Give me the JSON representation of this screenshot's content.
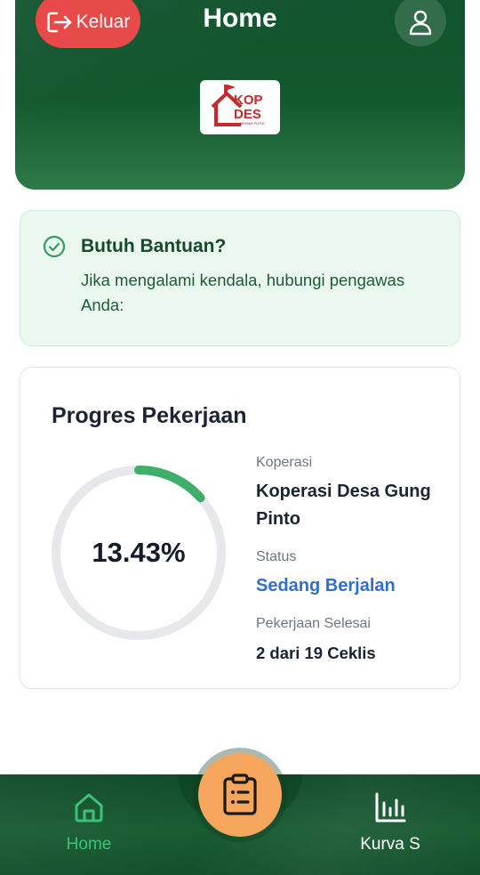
{
  "header": {
    "logout_label": "Keluar",
    "title": "Home",
    "logo_text_top": "KOP",
    "logo_text_bottom": "DES",
    "logo_subtext": "MERAH PUTIH"
  },
  "help": {
    "title": "Butuh Bantuan?",
    "text": "Jika mengalami kendala, hubungi pengawas Anda:"
  },
  "progress": {
    "title": "Progres Pekerjaan",
    "percent_label": "13.43%",
    "percent_value": 13.43,
    "koperasi_label": "Koperasi",
    "koperasi_value": "Koperasi Desa Gung Pinto",
    "status_label": "Status",
    "status_value": "Sedang Berjalan",
    "selesai_label": "Pekerjaan Selesai",
    "selesai_value": "2 dari 19 Ceklis"
  },
  "nav": {
    "home_label": "Home",
    "kurva_label": "Kurva S",
    "home_icon": "home-icon",
    "center_icon": "clipboard-list-icon",
    "kurva_icon": "bar-chart-icon"
  },
  "colors": {
    "brand_green": "#14582f",
    "logout_red": "#e84a4a",
    "progress_green": "#3fae6a",
    "status_blue": "#2f6fd0",
    "fab_orange": "#f6a65c",
    "active_nav": "#3cc27a"
  }
}
